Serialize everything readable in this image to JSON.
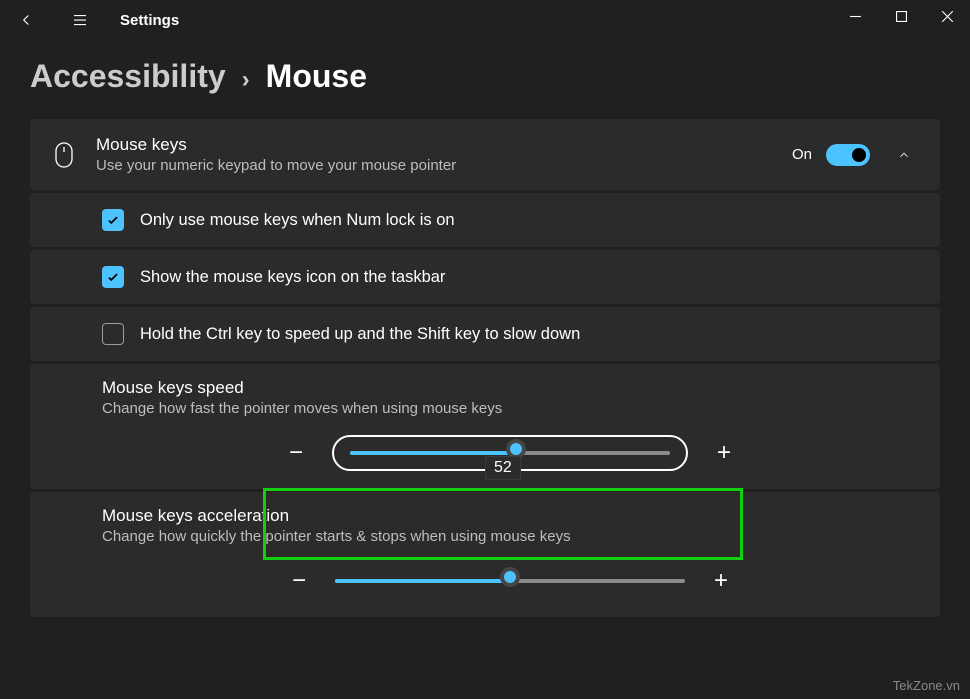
{
  "app_title": "Settings",
  "breadcrumb": {
    "parent": "Accessibility",
    "current": "Mouse"
  },
  "mouse_keys": {
    "title": "Mouse keys",
    "subtitle": "Use your numeric keypad to move your mouse pointer",
    "state_label": "On"
  },
  "options": {
    "numlock": {
      "label": "Only use mouse keys when Num lock is on",
      "checked": true
    },
    "taskbar": {
      "label": "Show the mouse keys icon on the taskbar",
      "checked": true
    },
    "ctrlshift": {
      "label": "Hold the Ctrl key to speed up and the Shift key to slow down",
      "checked": false
    }
  },
  "speed": {
    "title": "Mouse keys speed",
    "subtitle": "Change how fast the pointer moves when using mouse keys",
    "value": "52",
    "percent": 52
  },
  "accel": {
    "title": "Mouse keys acceleration",
    "subtitle": "Change how quickly the pointer starts & stops when using mouse keys",
    "percent": 50
  },
  "watermark": "TekZone.vn"
}
